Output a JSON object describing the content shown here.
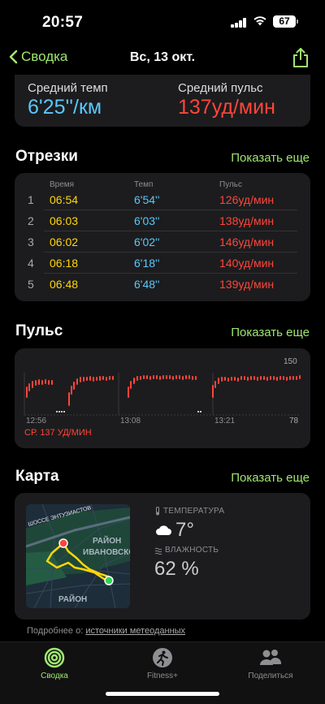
{
  "status": {
    "time": "20:57",
    "battery": "67"
  },
  "nav": {
    "back_label": "Сводка",
    "title": "Вс, 13 окт."
  },
  "averages": {
    "pace_label": "Средний темп",
    "pace_value": "6'25''/км",
    "hr_label": "Средний пульс",
    "hr_value": "137уд/мин"
  },
  "splits": {
    "title": "Отрезки",
    "show_more": "Показать еще",
    "headers": {
      "time": "Время",
      "pace": "Темп",
      "hr": "Пульс"
    },
    "rows": [
      {
        "n": "1",
        "time": "06:54",
        "pace": "6'54''",
        "hr": "126уд/мин"
      },
      {
        "n": "2",
        "time": "06:03",
        "pace": "6'03''",
        "hr": "138уд/мин"
      },
      {
        "n": "3",
        "time": "06:02",
        "pace": "6'02''",
        "hr": "146уд/мин"
      },
      {
        "n": "4",
        "time": "06:18",
        "pace": "6'18''",
        "hr": "140уд/мин"
      },
      {
        "n": "5",
        "time": "06:48",
        "pace": "6'48''",
        "hr": "139уд/мин"
      }
    ]
  },
  "heart_rate": {
    "title": "Пульс",
    "show_more": "Показать еще",
    "max_label": "150",
    "min_label": "78",
    "times": [
      "12:56",
      "13:08",
      "13:21"
    ],
    "avg_label": "СР. 137 УД/МИН"
  },
  "map": {
    "title": "Карта",
    "show_more": "Показать еще",
    "street_label": "ШОССЕ ЭНТУЗИАСТОВ",
    "district_label_1": "РАЙОН",
    "district_label_2": "ИВАНОВСКО",
    "district_label_3": "РАЙОН",
    "temperature_label": "ТЕМПЕРАТУРА",
    "temperature_value": "7°",
    "humidity_label": "ВЛАЖНОСТЬ",
    "humidity_value": "62 %"
  },
  "source": {
    "prefix": "Подробнее о:",
    "link": "источники метеоданных"
  },
  "tabs": [
    {
      "label": "Сводка",
      "icon": "activity-rings-icon",
      "active": true
    },
    {
      "label": "Fitness+",
      "icon": "fitness-runner-icon",
      "active": false
    },
    {
      "label": "Поделиться",
      "icon": "people-icon",
      "active": false
    }
  ],
  "colors": {
    "accent": "#9fe870",
    "pace": "#5ac8fa",
    "heart": "#ff453a",
    "split_time": "#ffd60a"
  }
}
